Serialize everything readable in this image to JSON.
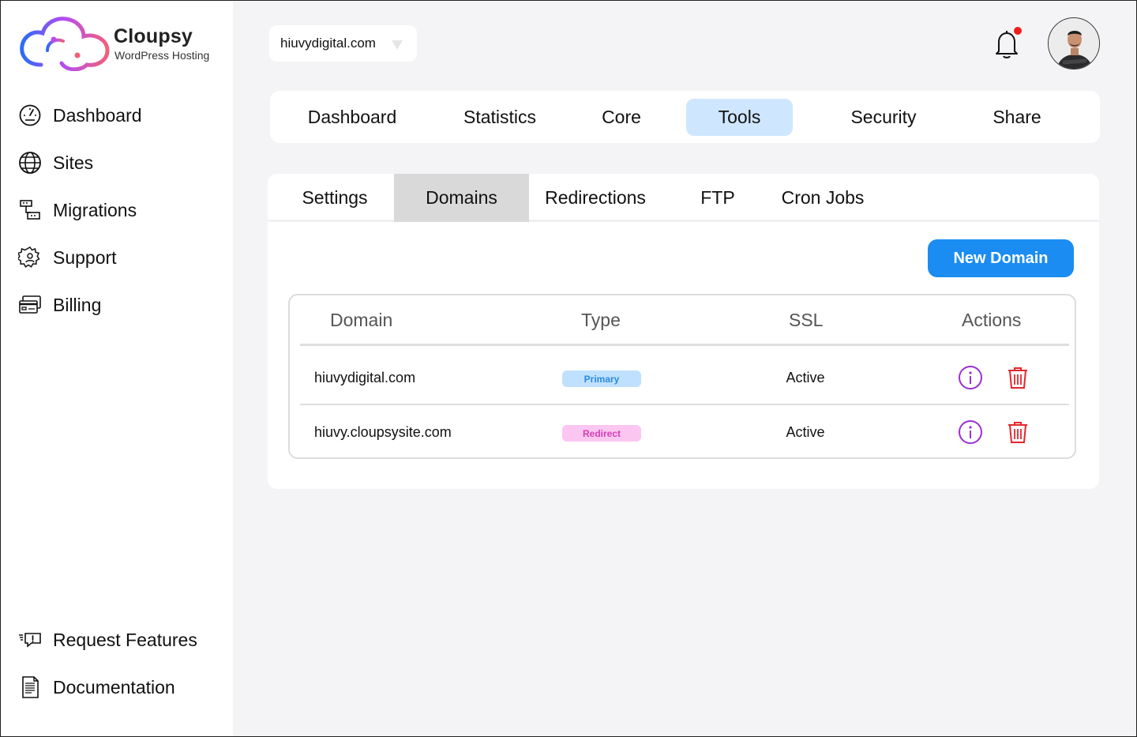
{
  "brand": {
    "name": "Cloupsy",
    "tagline": "WordPress Hosting",
    "colors": {
      "gradient_start": "#2b6cf5",
      "gradient_mid": "#b84cf0",
      "gradient_end": "#f0607a"
    }
  },
  "sidebar": {
    "items": [
      {
        "label": "Dashboard",
        "icon": "speedometer-icon"
      },
      {
        "label": "Sites",
        "icon": "globe-icon"
      },
      {
        "label": "Migrations",
        "icon": "migration-icon"
      },
      {
        "label": "Support",
        "icon": "support-gear-icon"
      },
      {
        "label": "Billing",
        "icon": "credit-card-icon"
      }
    ],
    "bottom_items": [
      {
        "label": "Request Features",
        "icon": "feature-request-icon"
      },
      {
        "label": "Documentation",
        "icon": "document-icon"
      }
    ]
  },
  "header": {
    "site_selector": {
      "value": "hiuvydigital.com",
      "icon": "caret-down-icon"
    },
    "notifications": {
      "icon": "bell-icon",
      "has_unread": true,
      "dot_color": "#f01d1d"
    },
    "avatar": {
      "icon": "user-avatar"
    }
  },
  "main_tabs": {
    "items": [
      {
        "label": "Dashboard"
      },
      {
        "label": "Statistics"
      },
      {
        "label": "Core"
      },
      {
        "label": "Tools",
        "active": true
      },
      {
        "label": "Security"
      },
      {
        "label": "Share"
      }
    ],
    "active_color": "#cfe6ff"
  },
  "sub_tabs": {
    "items": [
      {
        "label": "Settings"
      },
      {
        "label": "Domains",
        "active": true
      },
      {
        "label": "Redirections"
      },
      {
        "label": "FTP"
      },
      {
        "label": "Cron Jobs"
      }
    ]
  },
  "domains": {
    "new_button_label": "New Domain",
    "button_color": "#1a8cf2",
    "columns": [
      "Domain",
      "Type",
      "SSL",
      "Actions"
    ],
    "rows": [
      {
        "domain": "hiuvydigital.com",
        "type": "Primary",
        "ssl": "Active",
        "actions": [
          "info-icon",
          "trash-icon"
        ]
      },
      {
        "domain": "hiuvy.cloupsysite.com",
        "type": "Redirect",
        "ssl": "Active",
        "actions": [
          "info-icon",
          "trash-icon"
        ]
      }
    ],
    "colors": {
      "info": "#9b2fd6",
      "delete": "#e5262b"
    }
  }
}
